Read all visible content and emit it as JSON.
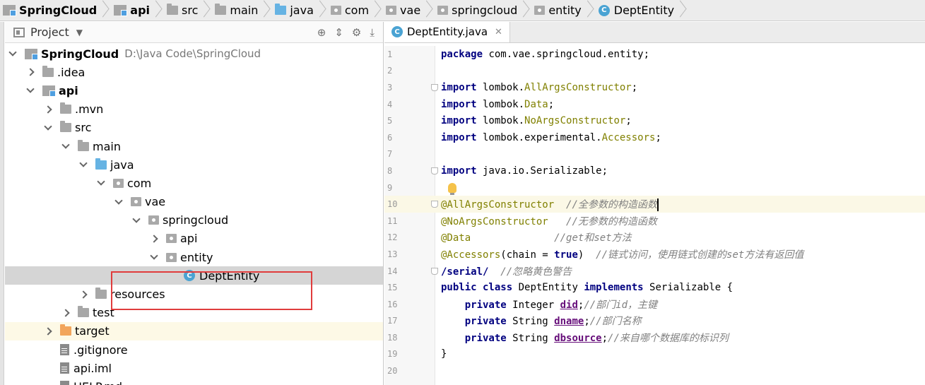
{
  "breadcrumbs": [
    {
      "label": "SpringCloud",
      "icon": "module-icon",
      "bold": true
    },
    {
      "label": "api",
      "icon": "module-icon",
      "bold": true
    },
    {
      "label": "src",
      "icon": "folder-icon"
    },
    {
      "label": "main",
      "icon": "folder-icon"
    },
    {
      "label": "java",
      "icon": "source-folder-icon"
    },
    {
      "label": "com",
      "icon": "package-icon"
    },
    {
      "label": "vae",
      "icon": "package-icon"
    },
    {
      "label": "springcloud",
      "icon": "package-icon"
    },
    {
      "label": "entity",
      "icon": "package-icon"
    },
    {
      "label": "DeptEntity",
      "icon": "class-icon"
    }
  ],
  "project_panel": {
    "title": "Project",
    "tree": [
      {
        "label": "SpringCloud",
        "path": "D:\\Java Code\\SpringCloud",
        "depth": 0,
        "state": "open",
        "icon": "module-icon",
        "bold": true
      },
      {
        "label": ".idea",
        "depth": 1,
        "state": "closed",
        "icon": "folder-icon"
      },
      {
        "label": "api",
        "depth": 1,
        "state": "open",
        "icon": "module-icon",
        "bold": true
      },
      {
        "label": ".mvn",
        "depth": 2,
        "state": "closed",
        "icon": "folder-icon"
      },
      {
        "label": "src",
        "depth": 2,
        "state": "open",
        "icon": "folder-icon"
      },
      {
        "label": "main",
        "depth": 3,
        "state": "open",
        "icon": "folder-icon"
      },
      {
        "label": "java",
        "depth": 4,
        "state": "open",
        "icon": "source-folder-icon"
      },
      {
        "label": "com",
        "depth": 5,
        "state": "open",
        "icon": "package-icon"
      },
      {
        "label": "vae",
        "depth": 6,
        "state": "open",
        "icon": "package-icon"
      },
      {
        "label": "springcloud",
        "depth": 7,
        "state": "open",
        "icon": "package-icon"
      },
      {
        "label": "api",
        "depth": 8,
        "state": "closed",
        "icon": "package-icon"
      },
      {
        "label": "entity",
        "depth": 8,
        "state": "open",
        "icon": "package-icon"
      },
      {
        "label": "DeptEntity",
        "depth": 9,
        "state": "none",
        "icon": "class-icon",
        "selected": true
      },
      {
        "label": "resources",
        "depth": 4,
        "state": "closed",
        "icon": "resources-folder-icon"
      },
      {
        "label": "test",
        "depth": 3,
        "state": "closed",
        "icon": "folder-icon"
      },
      {
        "label": "target",
        "depth": 2,
        "state": "closed",
        "icon": "target-folder-icon",
        "highlight": true
      },
      {
        "label": ".gitignore",
        "depth": 2,
        "state": "none",
        "icon": "file-icon"
      },
      {
        "label": "api.iml",
        "depth": 2,
        "state": "none",
        "icon": "file-icon"
      },
      {
        "label": "HELP.md",
        "depth": 2,
        "state": "none",
        "icon": "file-icon"
      }
    ]
  },
  "editor": {
    "tab_label": "DeptEntity.java",
    "lines": [
      {
        "n": "1",
        "parts": [
          [
            "kw",
            "package"
          ],
          [
            "plain",
            " com.vae.springcloud.entity;"
          ]
        ]
      },
      {
        "n": "2",
        "parts": []
      },
      {
        "n": "3",
        "fold": true,
        "parts": [
          [
            "kw",
            "import"
          ],
          [
            "plain",
            " lombok."
          ],
          [
            "gr",
            "AllArgsConstructor"
          ],
          [
            "plain",
            ";"
          ]
        ]
      },
      {
        "n": "4",
        "parts": [
          [
            "kw",
            "import"
          ],
          [
            "plain",
            " lombok."
          ],
          [
            "gr",
            "Data"
          ],
          [
            "plain",
            ";"
          ]
        ]
      },
      {
        "n": "5",
        "parts": [
          [
            "kw",
            "import"
          ],
          [
            "plain",
            " lombok."
          ],
          [
            "gr",
            "NoArgsConstructor"
          ],
          [
            "plain",
            ";"
          ]
        ]
      },
      {
        "n": "6",
        "parts": [
          [
            "kw",
            "import"
          ],
          [
            "plain",
            " lombok.experimental."
          ],
          [
            "gr",
            "Accessors"
          ],
          [
            "plain",
            ";"
          ]
        ]
      },
      {
        "n": "7",
        "parts": []
      },
      {
        "n": "8",
        "fold": true,
        "parts": [
          [
            "kw",
            "import"
          ],
          [
            "plain",
            " java.io.Serializable;"
          ]
        ]
      },
      {
        "n": "9",
        "bulb": true,
        "parts": []
      },
      {
        "n": "10",
        "current": true,
        "fold": true,
        "parts": [
          [
            "ann",
            "@AllArgsConstructor"
          ],
          [
            "plain",
            "  "
          ],
          [
            "cmt",
            "//全参数的构造函数"
          ]
        ]
      },
      {
        "n": "11",
        "parts": [
          [
            "ann",
            "@NoArgsConstructor"
          ],
          [
            "plain",
            "   "
          ],
          [
            "cmt",
            "//无参数的构造函数"
          ]
        ]
      },
      {
        "n": "12",
        "parts": [
          [
            "ann",
            "@Data"
          ],
          [
            "plain",
            "              "
          ],
          [
            "cmt",
            "//get和set方法"
          ]
        ]
      },
      {
        "n": "13",
        "parts": [
          [
            "ann",
            "@Accessors"
          ],
          [
            "plain",
            "(chain = "
          ],
          [
            "kw",
            "true"
          ],
          [
            "plain",
            ")  "
          ],
          [
            "cmt",
            "//链式访问，使用链式创建的set方法有返回值"
          ]
        ]
      },
      {
        "n": "14",
        "fold": true,
        "parts": [
          [
            "kw",
            "/serial/"
          ],
          [
            "plain",
            "  "
          ],
          [
            "cmt",
            "//忽略黄色警告"
          ]
        ]
      },
      {
        "n": "15",
        "parts": [
          [
            "kw",
            "public class"
          ],
          [
            "plain",
            " DeptEntity "
          ],
          [
            "kw",
            "implements"
          ],
          [
            "plain",
            " Serializable {"
          ]
        ]
      },
      {
        "n": "16",
        "parts": [
          [
            "plain",
            "    "
          ],
          [
            "kw",
            "private"
          ],
          [
            "plain",
            " Integer "
          ],
          [
            "fld",
            "did"
          ],
          [
            "plain",
            ";"
          ],
          [
            "cmt",
            "//部门id，主键"
          ]
        ]
      },
      {
        "n": "17",
        "parts": [
          [
            "plain",
            "    "
          ],
          [
            "kw",
            "private"
          ],
          [
            "plain",
            " String "
          ],
          [
            "fld",
            "dname"
          ],
          [
            "plain",
            ";"
          ],
          [
            "cmt",
            "//部门名称"
          ]
        ]
      },
      {
        "n": "18",
        "parts": [
          [
            "plain",
            "    "
          ],
          [
            "kw",
            "private"
          ],
          [
            "plain",
            " String "
          ],
          [
            "fld",
            "dbsource"
          ],
          [
            "plain",
            ";"
          ],
          [
            "cmt",
            "//来自哪个数据库的标识列"
          ]
        ]
      },
      {
        "n": "19",
        "parts": [
          [
            "plain",
            "}"
          ]
        ]
      },
      {
        "n": "20",
        "parts": []
      }
    ]
  }
}
